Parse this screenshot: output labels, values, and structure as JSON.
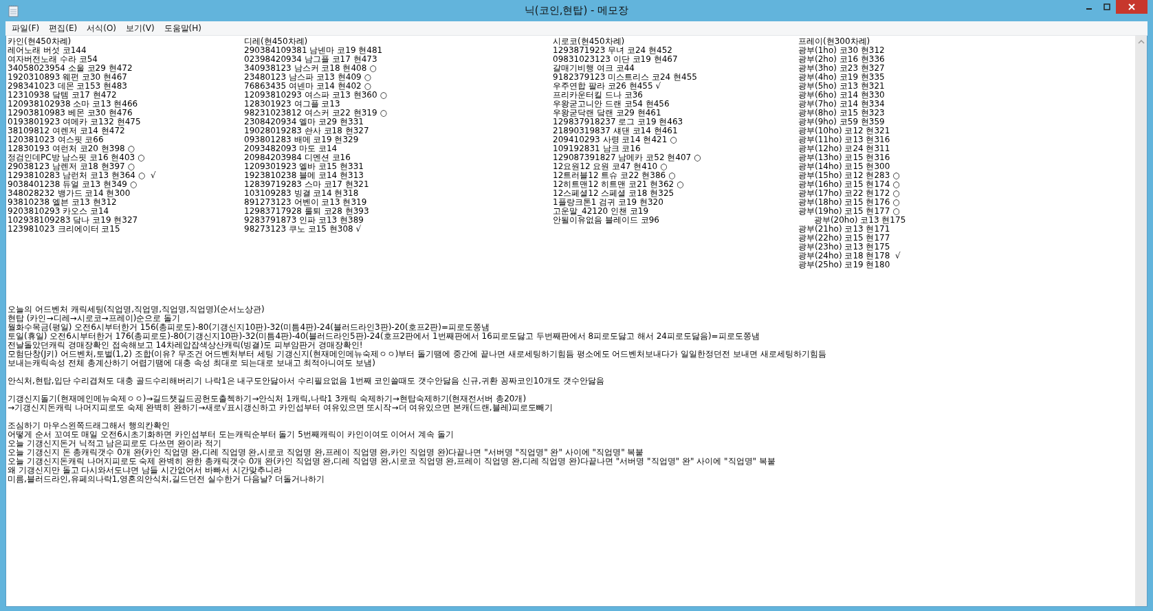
{
  "window": {
    "title": "닉(코인,현탑) - 메모장"
  },
  "menu": [
    "파일(F)",
    "편집(E)",
    "서식(O)",
    "보기(V)",
    "도움말(H)"
  ],
  "columns": [
    [
      "카인(현450차례)",
      "레어노래 버섯 코144",
      "여자버전노래 수라 코54",
      "34058023954 소울 코29 현472",
      "1920310893 웨펀 코30 현467",
      "298341023 데몬 코153 현483",
      "12310938 닼템 코17 현472",
      "120938102938 소마 코13 현466",
      "12903810983 베몬 코30 현476",
      "0193801923 여메카 코132 현475",
      "38109812 여렌저 코14 현472",
      "120381023 여스핏 코66",
      "12830193 여런처 코20 현398 ○",
      "정검인데PC방 남스핏 코16 현403 ○",
      "29038123 남렌저 코18 현397 ○",
      "1293810283 남런처 코13 현364 ○  √",
      "9038401238 듀얼 코13 현349 ○",
      "348028232 뱅가드 코14 현300",
      "93810238 엘븐 코13 현312",
      "9203810293 카오스 코14",
      "102938109283 닼나 코19 현327",
      "123981023 크리에이터 코15"
    ],
    [
      "디레(현450차례)",
      "290384109381 남넨마 코19 현481",
      "02398420934 남그플 코17 현473",
      "340938123 남스커 코18 현408 ○",
      "23480123 남스파 코13 현409 ○",
      "76863435 여넨마 코14 현402 ○",
      "12093810293 여스파 코13 현360 ○",
      "128301923 여그플 코13",
      "98231023812 여스커 코22 현319 ○",
      "2308420934 엘마 코29 현331",
      "19028019283 솬사 코18 현327",
      "093801283 배메 코19 현329",
      "2093482093 마도 코14",
      "20984203984 디멘션 코16",
      "1209301923 엘바 코15 현331",
      "1923810238 블메 코14 현313",
      "12839719283 스마 코17 현321",
      "103109283 빙결 코14 현318",
      "891273123 어벤이 코13 현319",
      "12983717928 룰퇴 코28 현393",
      "9283791873 인파 코13 현389",
      "98273123 쿠노 코15 현308 √"
    ],
    [
      "시로코(현450차례)",
      "1293871923 무녀 코24 현452",
      "09831023123 이단 코19 현467",
      "갈매기비행 여크 코44",
      "9182379123 미스트리스 코24 현455",
      "우주연합 팔라 코26 현455 √",
      "프리카운터킬 드나 코36",
      "우왕굳고니안 드랜 코54 현456",
      "우왕굳닥랜 닼랜 코29 현461",
      "129837918237 로그 코19 현463",
      "21890319837 섀댄 코14 현461",
      "209410293 사령 코14 현421 ○",
      "109192831 남크 코16",
      "129087391827 남메카 코52 현407 ○",
      "12요원12 요원 코47 현410 ○",
      "12트러블12 트슈 코22 현386 ○",
      "12히트맨12 히트맨 코21 현362 ○",
      "12스페셜12 스페셜 코18 현325",
      "1플랑크톤1 검귀 코19 현320",
      "고운말_42120 인챈 코19",
      "안될이유없음 블레이드 코96"
    ],
    [
      "프레이(현300차례)",
      "광부(1ho) 코30 현312",
      "광부(2ho) 코16 현336",
      "광부(3ho) 코23 현327",
      "광부(4ho) 코19 현335",
      "광부(5ho) 코13 현321",
      "광부(6ho) 코14 현330",
      "광부(7ho) 코14 현334",
      "광부(8ho) 코15 현323",
      "광부(9ho) 코59 현359",
      "광부(10ho) 코12 현321",
      "광부(11ho) 코13 현316",
      "광부(12ho) 코24 현311",
      "광부(13ho) 코15 현316",
      "광부(14ho) 코15 현300",
      "광부(15ho) 코12 현283 ○",
      "광부(16ho) 코15 현174 ○",
      "광부(17ho) 코22 현172 ○",
      "광부(18ho) 코15 현176 ○",
      "광부(19ho) 코15 현177 ○",
      "      광부(20ho) 코13 현175",
      "광부(21ho) 코13 현171",
      "광부(22ho) 코15 현177",
      "광부(23ho) 코13 현175",
      "광부(24ho) 코18 현178  √",
      "광부(25ho) 코19 현180"
    ]
  ],
  "notes": [
    [
      "오늘의 어드벤처 캐릭세팅(직업명,직업명,직업명,직업명)(순서노상관)",
      "현탑 (카인→디레→시로코→프레이)순으로 돌기",
      "월화수목금(평일) 오전6시부터한거 156(총피로도)-80(기갱신지10판)-32(미틈4판)-24(블러드라인3판)-20(호프2판)=피로도쫑냄",
      "토일(휴일) 오전6시부터한거 176(총피로도)-80(기갱신지10판)-32(미틈4판)-40(블러드라인5판)-24(호프2판에서 1번째판에서 16피로도닳고 두번째판에서 8피로도닳고 해서 24피로도닳음)=피로도쫑냄",
      "전날돌았던캐릭 경매장확인 접속해보고 14차레압잡색상산캐릭(빙결)도 피부암판거 경매장확인!",
      "모험단창(J키) 어드벤처,토벌(1,2) 조합(이유? 무조건 어드벤처부터 세팅 기갱신지(현재메인메뉴숙제ㅇㅇ)부터 돌기땜에 중간에 끝나면 새로세팅하기힘듬 평소에도 어드벤처보내다가 일일한정던전 보내면 새로세팅하기힘듬",
      "보내는캐릭속성 전체 총계산하기 어렵기땜에 대충 속성 최대로 되는대로 보내고 최적아니여도 보냄)"
    ],
    [
      "안식처,현탑,입단 수리겹쳐도 대충 골드수리해버리기 나락1은 내구도안닳아서 수리필요없음 1번째 코인쓸때도 갯수안닳음 신규,귀환 꽁짜코인10개도 갯수안닳음"
    ],
    [
      "기갱신지돌기(현재메인메뉴숙제ㅇㅇ)→길드챗길드공헌도출첵하기→안식처 1캐릭,나락1 3캐릭 숙제하기→현탑숙제하기(현재전서버 총20개)",
      "→기갱신지돈캐릭 나머지피로도 숙제 완벽히 완하기→새로√표시갱신하고 카인섭부터 여유있으면 또시작→더 여유있으면 본캐(드랜,블레)피로도빼기"
    ],
    [
      "조심하기 마우스왼쪽드래그해서 행의칸확인",
      "어떻게 순서 꼬여도 매일 오전6시초기화하면 카인섭부터 도는캐릭순부터 돌기 5번째캐릭이 카인이여도 이어서 계속 돌기",
      "오늘 기갱신지돈거 닉적고 남은피로도 다쓰면 완이라 적기",
      "오늘 기갱신지 돈 총캐릭갯수 0개 완(카인 직업명 완,디레 직업명 완,시로코 직업명 완,프레이 직업명 완,카인 직업명 완)다끝나면 \"서버명 \"직업명\" 완\" 사이에 \"직업명\" 복붙",
      "오늘 기갱신지돈캐릭 나머지피로도 숙제 완벽히 완한 총캐릭갯수 0개 완(카인 직업명 완,디레 직업명 완,시로코 직업명 완,프레이 직업명 완,디레 직업명 완)다끝나면 \"서버명 \"직업명\" 완\" 사이에 \"직업명\" 복붙",
      "왜 기갱신지만 돌고 다시와서도냐면 남들 시간없어서 바빠서 시간맞추니라",
      "미름,블러드라인,유페의나락1,영혼의안식처,길드던전 실수한거 다음날? 더돌거나하기"
    ]
  ]
}
